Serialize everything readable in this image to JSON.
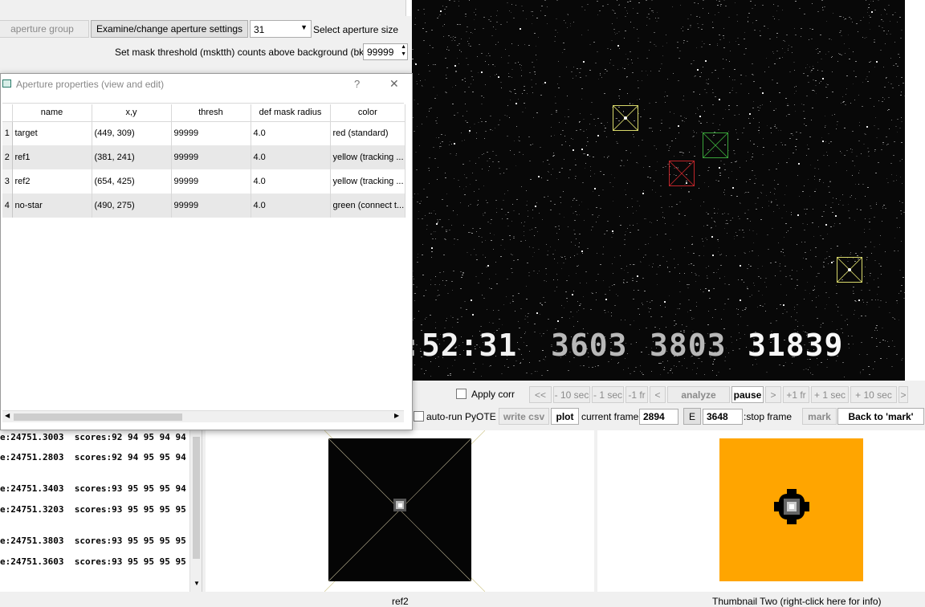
{
  "top_panel": {
    "aperture_group_label": "aperture group",
    "examine_button": "Examine/change aperture settings",
    "aperture_size_value": "31",
    "select_size_label": "Select aperture size",
    "mask_threshold_label": "Set mask threshold (msktth) counts above background (bkavg)",
    "mask_threshold_value": "99999"
  },
  "dialog": {
    "title": "Aperture properties (view and edit)",
    "help": "?",
    "close": "✕",
    "columns": [
      "name",
      "x,y",
      "thresh",
      "def mask radius",
      "color"
    ],
    "rows": [
      {
        "num": "1",
        "name": "target",
        "xy": "(449, 309)",
        "thresh": "99999",
        "radius": "4.0",
        "color": "red (standard)"
      },
      {
        "num": "2",
        "name": "ref1",
        "xy": "(381, 241)",
        "thresh": "99999",
        "radius": "4.0",
        "color": "yellow (tracking ..."
      },
      {
        "num": "3",
        "name": "ref2",
        "xy": "(654, 425)",
        "thresh": "99999",
        "radius": "4.0",
        "color": "yellow (tracking ..."
      },
      {
        "num": "4",
        "name": "no-star",
        "xy": "(490, 275)",
        "thresh": "99999",
        "radius": "4.0",
        "color": "green (connect t..."
      }
    ]
  },
  "video": {
    "time": ":52:31",
    "field1": "3603",
    "field2": "3803",
    "frame": "31839"
  },
  "controls": {
    "apply_corr": "Apply corr",
    "auto_run": "auto-run PyOTE",
    "write_csv": "write csv",
    "plot": "plot",
    "current_frame_label": "current frame:",
    "current_frame_value": "2894",
    "e_button": "E",
    "stop_frame_value": "3648",
    "stop_frame_label": ":stop frame",
    "mark": "mark",
    "back_to_mark": "Back to 'mark'",
    "nav": [
      "<<",
      "- 10 sec",
      "- 1 sec",
      "-1 fr",
      "<",
      "analyze",
      "pause",
      ">",
      "+1 fr",
      "+ 1 sec",
      "+ 10 sec",
      ">"
    ]
  },
  "log": {
    "lines": [
      "e:24751.3003  scores:92 94 95 94 94",
      "e:24751.2803  scores:92 94 95 95 94",
      "e:24751.3403  scores:93 95 95 95 94",
      "e:24751.3203  scores:93 95 95 95 95",
      "e:24751.3803  scores:93 95 95 95 95",
      "e:24751.3603  scores:93 95 95 95 95"
    ]
  },
  "thumbnails": {
    "one_caption": "ref2",
    "two_caption": "Thumbnail Two (right-click here for info)"
  },
  "colors": {
    "target_box": "#c0262b",
    "tracking_box": "#d8d86a",
    "connect_box": "#3aa43a",
    "thumb_two_bg": "#ffa500"
  }
}
